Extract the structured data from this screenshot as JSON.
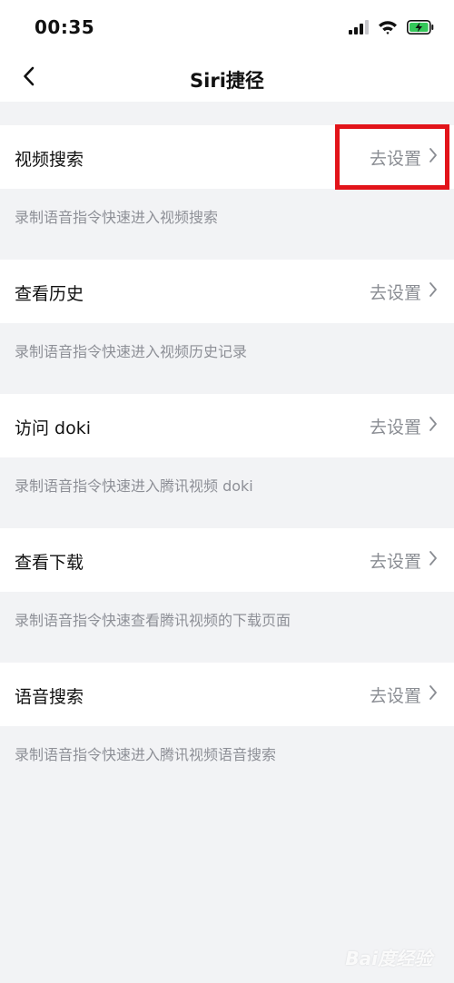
{
  "status_bar": {
    "time": "00:35",
    "icons": [
      "cellular-signal-icon",
      "wifi-icon",
      "battery-charging-icon"
    ]
  },
  "nav": {
    "back_icon": "chevron-left-icon",
    "title": "Siri捷径"
  },
  "items": [
    {
      "title": "视频搜索",
      "action": "去设置",
      "description": "录制语音指令快速进入视频搜索"
    },
    {
      "title": "查看历史",
      "action": "去设置",
      "description": "录制语音指令快速进入视频历史记录"
    },
    {
      "title": "访问 doki",
      "action": "去设置",
      "description": "录制语音指令快速进入腾讯视频 doki"
    },
    {
      "title": "查看下载",
      "action": "去设置",
      "description": "录制语音指令快速查看腾讯视频的下载页面"
    },
    {
      "title": "语音搜索",
      "action": "去设置",
      "description": "录制语音指令快速进入腾讯视频语音搜索"
    }
  ],
  "colors": {
    "background": "#f2f3f5",
    "highlight": "#e2141a",
    "battery": "#34c759",
    "secondary_text": "#8a8d93"
  },
  "watermark": "Bai度经验"
}
